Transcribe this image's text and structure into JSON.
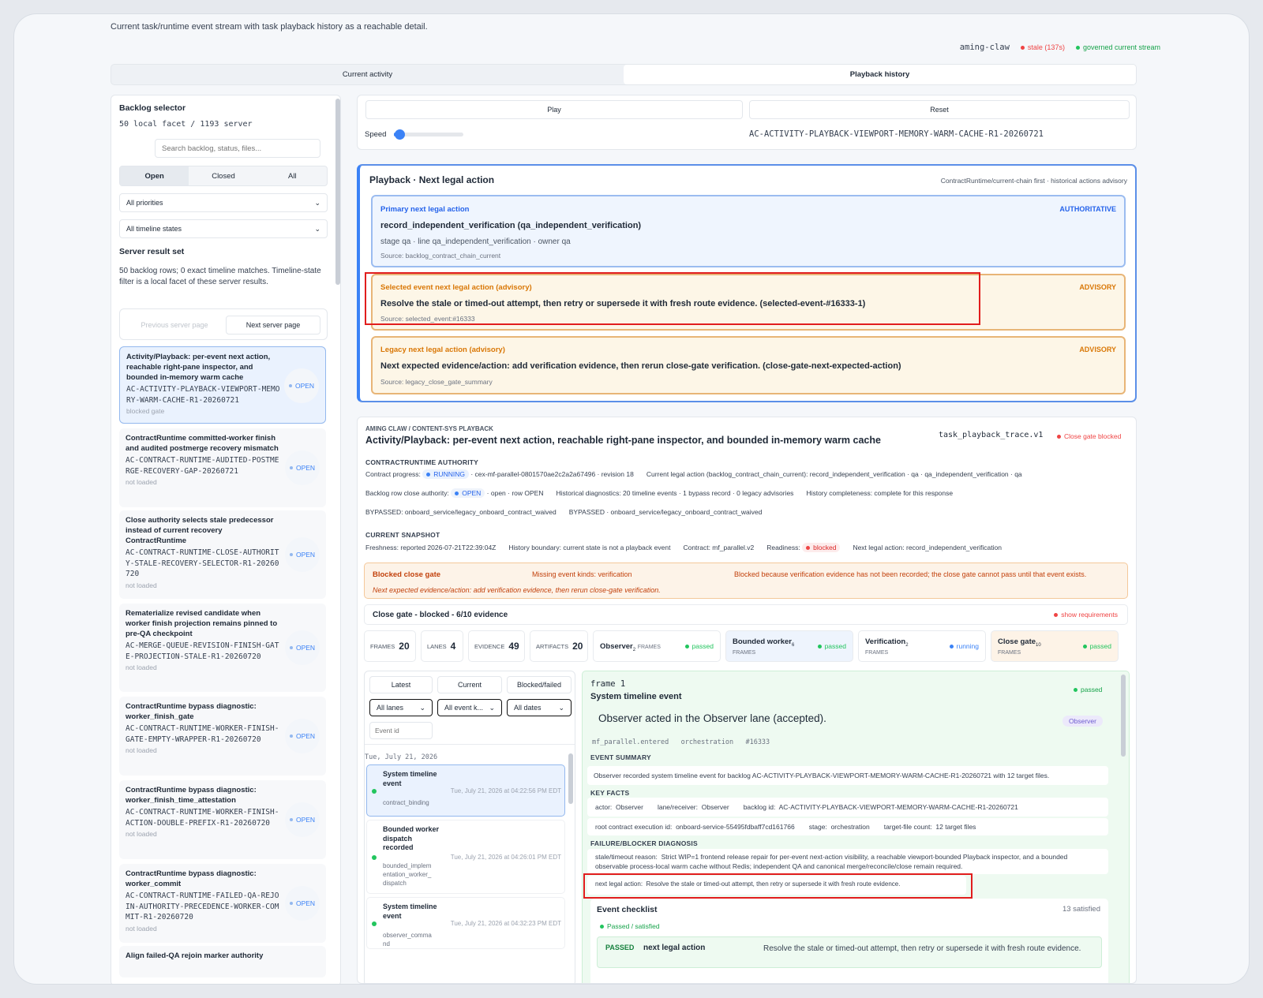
{
  "header": {
    "subtitle": "Current task/runtime event stream with task playback history as a reachable detail.",
    "agent": "aming-claw",
    "stale": "stale (137s)",
    "governed": "governed current stream"
  },
  "tabs": [
    "Current activity",
    "Playback history"
  ],
  "left": {
    "title": "Backlog selector",
    "count": "50 local facet / 1193 server",
    "search_placeholder": "Search backlog, status, files...",
    "filters": [
      "Open",
      "Closed",
      "All"
    ],
    "priority": "All priorities",
    "timeline": "All timeline states",
    "server_title": "Server result set",
    "server_text": "50 backlog rows; 0 exact timeline matches. Timeline-state filter is a local facet of these server results.",
    "prev": "Previous server page",
    "next": "Next server page",
    "open": "OPEN",
    "items": [
      {
        "title": "Activity/Playback: per-event next action, reachable right-pane inspector, and bounded in-memory warm cache",
        "code": "AC-ACTIVITY-PLAYBACK-VIEWPORT-MEMORY-WARM-CACHE-R1-20260721",
        "status": "blocked gate"
      },
      {
        "title": "ContractRuntime committed-worker finish and audited postmerge recovery mismatch",
        "code": "AC-CONTRACT-RUNTIME-AUDITED-POSTMERGE-RECOVERY-GAP-20260721",
        "status": "not loaded"
      },
      {
        "title": "Close authority selects stale predecessor instead of current recovery ContractRuntime",
        "code": "AC-CONTRACT-RUNTIME-CLOSE-AUTHORITY-STALE-RECOVERY-SELECTOR-R1-20260720",
        "status": "not loaded"
      },
      {
        "title": "Rematerialize revised candidate when worker finish projection remains pinned to pre-QA checkpoint",
        "code": "AC-MERGE-QUEUE-REVISION-FINISH-GATE-PROJECTION-STALE-R1-20260720",
        "status": "not loaded"
      },
      {
        "title": "ContractRuntime bypass diagnostic: worker_finish_gate",
        "code": "AC-CONTRACT-RUNTIME-WORKER-FINISH-GATE-EMPTY-WRAPPER-R1-20260720",
        "status": "not loaded"
      },
      {
        "title": "ContractRuntime bypass diagnostic: worker_finish_time_attestation",
        "code": "AC-CONTRACT-RUNTIME-WORKER-FINISH-ACTION-DOUBLE-PREFIX-R1-20260720",
        "status": "not loaded"
      },
      {
        "title": "ContractRuntime bypass diagnostic: worker_commit",
        "code": "AC-CONTRACT-RUNTIME-FAILED-QA-REJOIN-AUTHORITY-PRECEDENCE-WORKER-COMMIT-R1-20260720",
        "status": "not loaded"
      },
      {
        "title": "Align failed-QA rejoin marker authority",
        "code": "",
        "status": ""
      }
    ]
  },
  "controls": {
    "play": "Play",
    "reset": "Reset",
    "speed": "Speed",
    "speed_value": 0.05,
    "task_id": "AC-ACTIVITY-PLAYBACK-VIEWPORT-MEMORY-WARM-CACHE-R1-20260721"
  },
  "next": {
    "title": "Playback · Next legal action",
    "meta": "ContractRuntime/current-chain first · historical actions advisory",
    "primary": {
      "label": "Primary next legal action",
      "tag": "AUTHORITATIVE",
      "action": "record_independent_verification (qa_independent_verification)",
      "detail": "stage qa · line qa_independent_verification · owner qa",
      "source": "Source: backlog_contract_chain_current"
    },
    "selected": {
      "label": "Selected event next legal action (advisory)",
      "tag": "ADVISORY",
      "action": "Resolve the stale or timed-out attempt, then retry or supersede it with fresh route evidence. (selected-event-#16333-1)",
      "source": "Source: selected_event:#16333"
    },
    "legacy": {
      "label": "Legacy next legal action (advisory)",
      "tag": "ADVISORY",
      "action": "Next expected evidence/action: add verification evidence, then rerun close-gate verification. (close-gate-next-expected-action)",
      "source": "Source: legacy_close_gate_summary"
    }
  },
  "detail": {
    "crumb": "AMING CLAW / CONTENT-SYS PLAYBACK",
    "title": "Activity/Playback: per-event next action, reachable right-pane inspector, and bounded in-memory warm cache",
    "trace": "task_playback_trace.v1",
    "gate": "Close gate blocked",
    "authority_label": "CONTRACTRUNTIME AUTHORITY",
    "progress_label": "Contract progress:",
    "progress_state": "RUNNING",
    "progress_rest": "· cex-mf-parallel-0801570ae2c2a2a67496 · revision 18",
    "current_legal": "Current legal action (backlog_contract_chain_current): record_independent_verification · qa · qa_independent_verification · qa",
    "row_label": "Backlog row close authority:",
    "row_state": "OPEN",
    "row_rest": "· open · row OPEN",
    "hist": "Historical diagnostics: 20 timeline events · 1 bypass record · 0 legacy advisories",
    "completeness": "History completeness: complete for this response",
    "bypass1": "BYPASSED: onboard_service/legacy_onboard_contract_waived",
    "bypass2": "BYPASSED · onboard_service/legacy_onboard_contract_waived",
    "snapshot_label": "CURRENT SNAPSHOT",
    "fresh": "Freshness: reported 2026-07-21T22:39:04Z",
    "boundary": "History boundary: current state is not a playback event",
    "contract": "Contract: mf_parallel.v2",
    "readiness_label": "Readiness:",
    "readiness": "blocked",
    "next_legal": "Next legal action: record_independent_verification",
    "blocked_title": "Blocked close gate",
    "missing": "Missing event kinds: verification",
    "because": "Blocked because verification evidence has not been recorded; the close gate cannot pass until that event exists.",
    "expected": "Next expected evidence/action: add verification evidence, then rerun close-gate verification.",
    "closegate": "Close gate - blocked - 6/10 evidence",
    "show_req": "show requirements",
    "stats": [
      {
        "k": "FRAMES",
        "v": "20"
      },
      {
        "k": "LANES",
        "v": "4"
      },
      {
        "k": "EVIDENCE",
        "v": "49"
      },
      {
        "k": "ARTIFACTS",
        "v": "20"
      }
    ],
    "lanes": [
      {
        "name": "Observer",
        "n": "2",
        "unit": "FRAMES",
        "state": "passed",
        "color": "#22c55e",
        "bg": "#ffffff"
      },
      {
        "name": "Bounded worker",
        "n": "6",
        "unit": "FRAMES",
        "state": "passed",
        "color": "#22c55e",
        "bg": "#eef4fd"
      },
      {
        "name": "Verification",
        "n": "2",
        "unit": "FRAMES",
        "state": "running",
        "color": "#3b82f6",
        "bg": "#ffffff"
      },
      {
        "name": "Close gate",
        "n": "10",
        "unit": "FRAMES",
        "state": "passed",
        "color": "#22c55e",
        "bg": "#fdf3e7"
      }
    ],
    "ftabs": [
      "Latest",
      "Current",
      "Blocked/failed"
    ],
    "fsel": [
      "All lanes",
      "All event k...",
      "All dates"
    ],
    "event_placeholder": "Event id",
    "date": "Tue, July 21, 2026",
    "events": [
      {
        "title": "System timeline event",
        "sub": "contract_binding",
        "time": "Tue, July 21, 2026 at 04:22:56 PM EDT"
      },
      {
        "title": "Bounded worker dispatch recorded",
        "sub": "bounded_implementation_worker_dispatch",
        "time": "Tue, July 21, 2026 at 04:26:01 PM EDT"
      },
      {
        "title": "System timeline event",
        "sub": "observer_command",
        "time": "Tue, July 21, 2026 at 04:32:23 PM EDT"
      }
    ],
    "frame": {
      "num": "frame 1",
      "kind": "System timeline event",
      "state": "passed",
      "headline": "Observer acted in the Observer lane (accepted).",
      "lane": "Observer",
      "tags": "mf_parallel.entered   orchestration   #16333",
      "summary_label": "EVENT SUMMARY",
      "summary": "Observer recorded system timeline event for backlog AC-ACTIVITY-PLAYBACK-VIEWPORT-MEMORY-WARM-CACHE-R1-20260721 with 12 target files.",
      "facts_label": "KEY FACTS",
      "actor_k": "actor:",
      "actor_v": "Observer",
      "lane_k": "lane/receiver:",
      "lane_v": "Observer",
      "bid_k": "backlog id:",
      "bid_v": "AC-ACTIVITY-PLAYBACK-VIEWPORT-MEMORY-WARM-CACHE-R1-20260721",
      "root_k": "root contract execution id:",
      "root_v": "onboard-service-55495fdbaff7cd161766",
      "stage_k": "stage:",
      "stage_v": "orchestration",
      "tf_k": "target-file count:",
      "tf_v": "12 target files",
      "fail_label": "FAILURE/BLOCKER DIAGNOSIS",
      "stale_k": "stale/timeout reason:",
      "stale_v": "Strict WIP=1 frontend release repair for per-event next-action visibility, a reachable viewport-bounded Playback inspector, and a bounded observable process-local warm cache without Redis; independent QA and canonical merge/reconcile/close remain required.",
      "nla_k": "next legal action:",
      "nla_v": "Resolve the stale or timed-out attempt, then retry or supersede it with fresh route evidence.",
      "check_title": "Event checklist",
      "check_count": "13 satisfied",
      "check_state": "Passed / satisfied",
      "row_tag": "PASSED",
      "row_k": "next legal action",
      "row_v": "Resolve the stale or timed-out attempt, then retry or supersede it with fresh route evidence."
    }
  }
}
